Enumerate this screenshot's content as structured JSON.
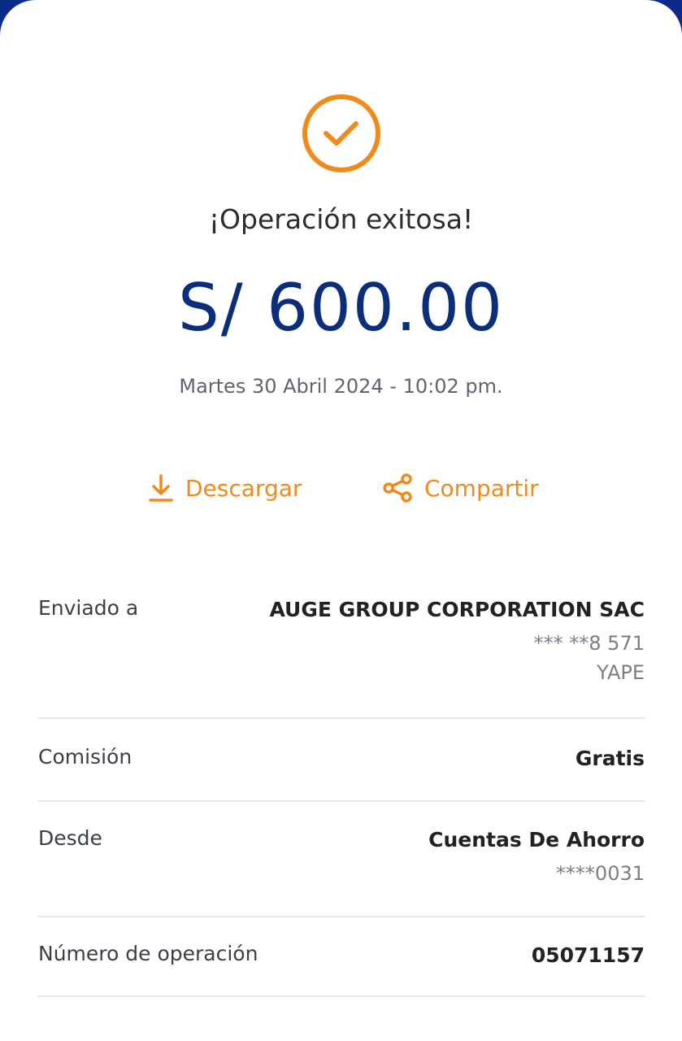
{
  "status": {
    "title": "¡Operación exitosa!",
    "amount": "S/ 600.00",
    "datetime": "Martes 30 Abril 2024 - 10:02 pm."
  },
  "actions": {
    "download_label": "Descargar",
    "share_label": "Compartir"
  },
  "details": {
    "sent_to": {
      "label": "Enviado a",
      "name": "AUGE GROUP CORPORATION SAC",
      "phone": "*** **8 571",
      "channel": "YAPE"
    },
    "commission": {
      "label": "Comisión",
      "value": "Gratis"
    },
    "from": {
      "label": "Desde",
      "account": "Cuentas De Ahorro",
      "number": "****0031"
    },
    "operation": {
      "label": "Número de operación",
      "value": "05071157"
    }
  },
  "colors": {
    "accent": "#f08a1d",
    "amount": "#0b2e7a",
    "header": "#0b2a8a"
  },
  "icons": [
    "check-circle-icon",
    "download-icon",
    "share-icon"
  ]
}
